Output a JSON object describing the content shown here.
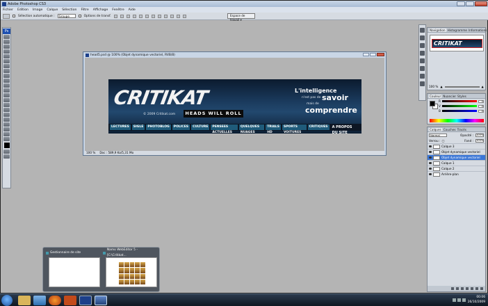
{
  "app": {
    "title": "Adobe Photoshop CS3",
    "menu": [
      "Fichier",
      "Edition",
      "Image",
      "Calque",
      "Sélection",
      "Filtre",
      "Affichage",
      "Fenêtre",
      "Aide"
    ]
  },
  "options": {
    "auto_select_label": "Sélection automatique :",
    "auto_select_value": "Groupe",
    "transform_label": "Options de transf.",
    "workspace": "Espace de travail"
  },
  "toolbox": {
    "logo": "Ps"
  },
  "document": {
    "title": "head5.psd @ 100% (Objet dynamique vectoriel, RVB/8)",
    "zoom": "100 %",
    "doc_info": "Doc : 589,9 Ko/5,31 Mo"
  },
  "banner": {
    "logo": "CRITIKAT",
    "slogan": "HEADS WILL ROLL",
    "copyright": "© 2009 Critikat.com",
    "tag1": "L'intelligence",
    "tag2": "n'est pas de",
    "tag3": "savoir",
    "tag4": "mais de",
    "tag5": "comprendre",
    "nav": [
      "LECTURES",
      "SIGLE",
      "PHOTOBLOG",
      "POLICES",
      "CULTURE",
      "PENSEES ACTUELLES",
      "QUELQUES NUAGES",
      "TRIALS HD",
      "SPORTS VOITURES",
      "CRITIQUES"
    ],
    "nav_right": "A PROPOS DU SITE"
  },
  "navigator": {
    "tabs": [
      "Navigation",
      "Histogramme",
      "Informations"
    ],
    "thumb_logo": "CRITIKAT",
    "zoom": "100 %"
  },
  "color": {
    "tabs": [
      "Couleur",
      "Nuancier",
      "Styles"
    ],
    "r": "0",
    "g": "0",
    "b": "0"
  },
  "layers": {
    "tabs": [
      "Calques",
      "Couches",
      "Tracés"
    ],
    "mode": "Normal",
    "opacity_label": "Opacité :",
    "opacity": "100%",
    "lock_label": "Verrou :",
    "fill_label": "Fond :",
    "fill": "100%",
    "items": [
      {
        "name": "Calque 3",
        "selected": false
      },
      {
        "name": "Objet dynamique vectoriel",
        "selected": false
      },
      {
        "name": "Objet dynamique vectoriel",
        "selected": true
      },
      {
        "name": "Calque 1",
        "selected": false
      },
      {
        "name": "Calque 2",
        "selected": false
      },
      {
        "name": "Arrière-plan",
        "selected": false
      }
    ]
  },
  "taskbar": {
    "preview1": "Gestionnaire de site",
    "preview2": "Namo WebEditor 5 - [C:\\Critikat...",
    "time": "00:06",
    "date": "26/10/2009"
  }
}
